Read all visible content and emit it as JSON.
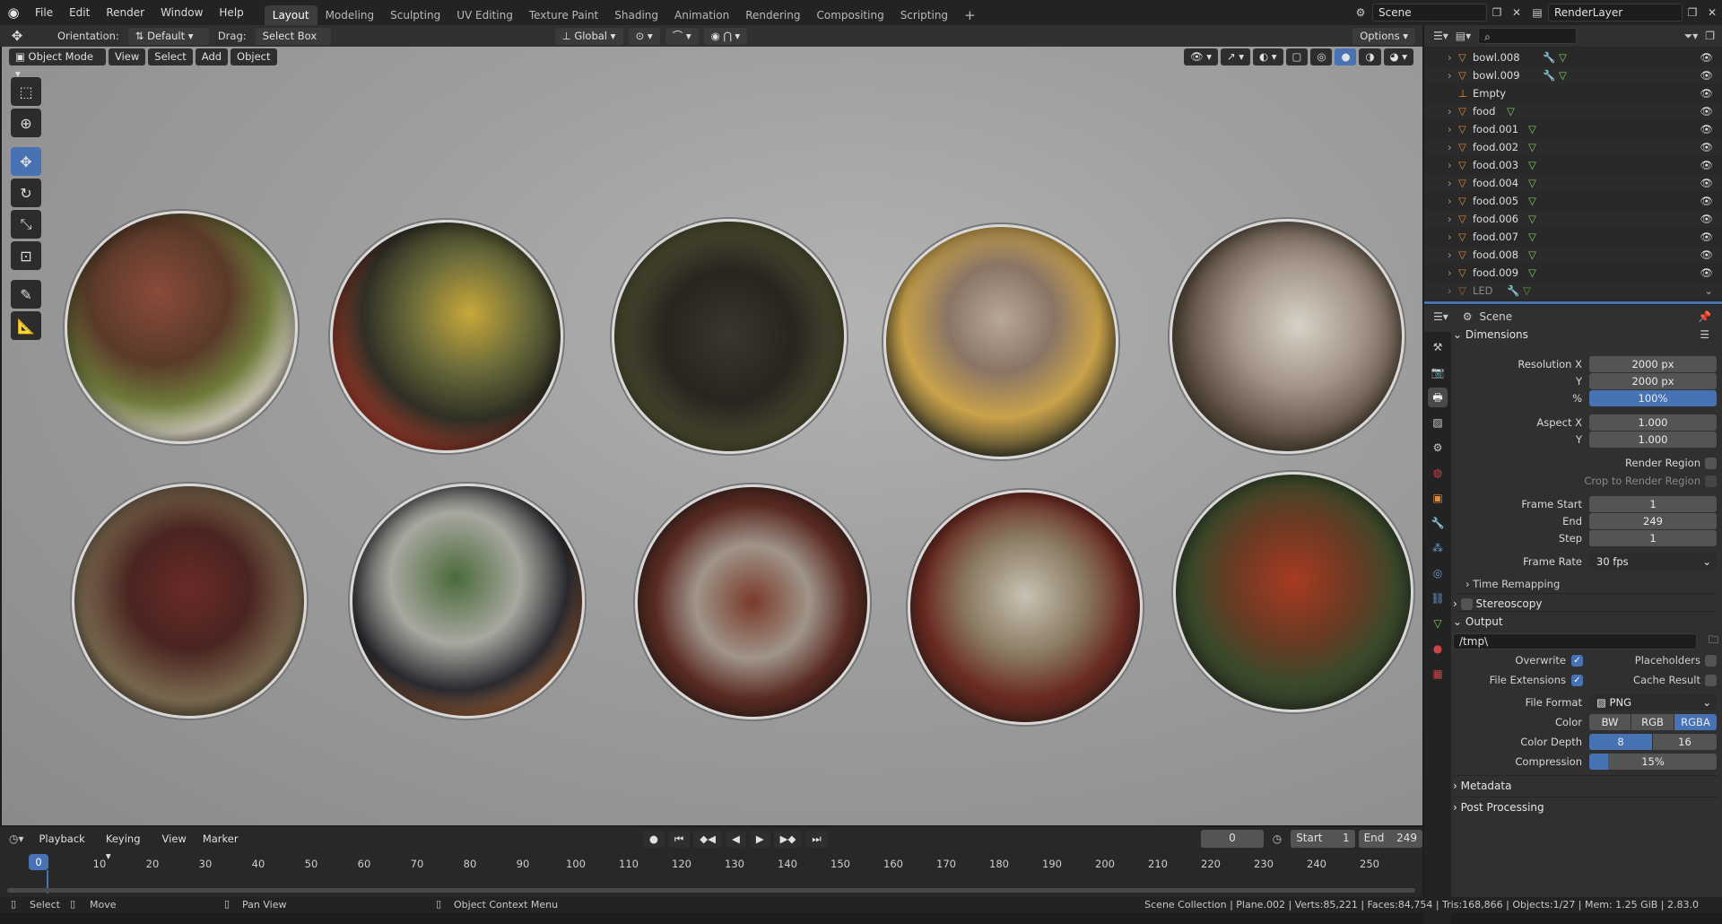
{
  "topbar": {
    "menus": [
      "File",
      "Edit",
      "Render",
      "Window",
      "Help"
    ],
    "workspaces": [
      "Layout",
      "Modeling",
      "Sculpting",
      "UV Editing",
      "Texture Paint",
      "Shading",
      "Animation",
      "Rendering",
      "Compositing",
      "Scripting"
    ],
    "active_workspace": "Layout",
    "add_tab": "+",
    "scene": "Scene",
    "view_layer": "RenderLayer"
  },
  "tool_header": {
    "orientation_label": "Orientation:",
    "orientation_value": "Default",
    "drag_label": "Drag:",
    "drag_value": "Select Box",
    "transform_orientation": "Global",
    "options": "Options"
  },
  "viewport": {
    "mode": "Object Mode",
    "menus": [
      "View",
      "Select",
      "Add",
      "Object"
    ]
  },
  "outliner": {
    "rows": [
      {
        "name": "bowl.008",
        "icons": [
          "wrench",
          "mesh"
        ]
      },
      {
        "name": "bowl.009",
        "icons": [
          "wrench",
          "mesh"
        ]
      },
      {
        "name": "Empty",
        "icons": []
      },
      {
        "name": "food",
        "icons": [
          "mesh"
        ]
      },
      {
        "name": "food.001",
        "icons": [
          "mesh"
        ]
      },
      {
        "name": "food.002",
        "icons": [
          "mesh"
        ]
      },
      {
        "name": "food.003",
        "icons": [
          "mesh"
        ]
      },
      {
        "name": "food.004",
        "icons": [
          "mesh"
        ]
      },
      {
        "name": "food.005",
        "icons": [
          "mesh"
        ]
      },
      {
        "name": "food.006",
        "icons": [
          "mesh"
        ]
      },
      {
        "name": "food.007",
        "icons": [
          "mesh"
        ]
      },
      {
        "name": "food.008",
        "icons": [
          "mesh"
        ]
      },
      {
        "name": "food.009",
        "icons": [
          "mesh"
        ]
      },
      {
        "name": "LED",
        "icons": [
          "wrench",
          "mesh"
        ]
      }
    ]
  },
  "properties": {
    "context": "Scene",
    "dimensions": {
      "title": "Dimensions",
      "resolution_x_label": "Resolution X",
      "resolution_x": "2000 px",
      "y_label": "Y",
      "resolution_y": "2000 px",
      "percent_label": "%",
      "percent": "100%",
      "aspect_x_label": "Aspect X",
      "aspect_x": "1.000",
      "aspect_y_label": "Y",
      "aspect_y": "1.000",
      "render_region": "Render Region",
      "crop_region": "Crop to Render Region",
      "frame_start_label": "Frame Start",
      "frame_start": "1",
      "end_label": "End",
      "end": "249",
      "step_label": "Step",
      "step": "1",
      "frame_rate_label": "Frame Rate",
      "frame_rate": "30 fps",
      "time_remapping": "Time Remapping"
    },
    "stereoscopy": "Stereoscopy",
    "output": {
      "title": "Output",
      "path": "/tmp\\",
      "overwrite": "Overwrite",
      "placeholders": "Placeholders",
      "file_extensions": "File Extensions",
      "cache_result": "Cache Result",
      "file_format_label": "File Format",
      "file_format": "PNG",
      "color_label": "Color",
      "color_options": [
        "BW",
        "RGB",
        "RGBA"
      ],
      "color_selected": "RGBA",
      "color_depth_label": "Color Depth",
      "color_depth_options": [
        "8",
        "16"
      ],
      "compression_label": "Compression",
      "compression": "15%",
      "compression_value": 0.15
    },
    "metadata": "Metadata",
    "post_processing": "Post Processing"
  },
  "timeline": {
    "menus": [
      "Playback",
      "Keying",
      "View",
      "Marker"
    ],
    "current_frame": "0",
    "start_label": "Start",
    "start": "1",
    "end_label": "End",
    "end": "249",
    "ticks": [
      "0",
      "10",
      "20",
      "30",
      "40",
      "50",
      "60",
      "70",
      "80",
      "90",
      "100",
      "110",
      "120",
      "130",
      "140",
      "150",
      "160",
      "170",
      "180",
      "190",
      "200",
      "210",
      "220",
      "230",
      "240",
      "250"
    ]
  },
  "statusbar": {
    "select": "Select",
    "move": "Move",
    "pan": "Pan View",
    "context_menu": "Object Context Menu",
    "stats": "Scene Collection | Plane.002 | Verts:85,221 | Faces:84,754 | Tris:168,866 | Objects:1/27 | Mem: 1.25 GiB | 2.83.0"
  },
  "colors": {
    "accent": "#4772b3",
    "mesh_icon": "#7fcf5a",
    "object_icon": "#e08a3c"
  }
}
